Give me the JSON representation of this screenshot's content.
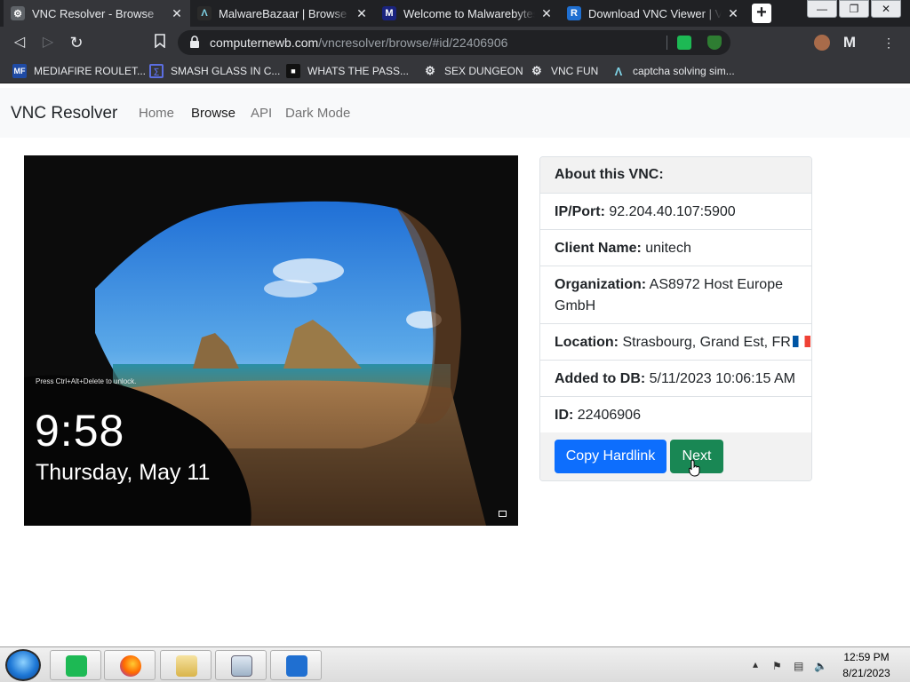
{
  "browser": {
    "tabs": [
      {
        "title": "VNC Resolver - Browse",
        "active": true
      },
      {
        "title": "MalwareBazaar | Browse Che",
        "active": false
      },
      {
        "title": "Welcome to Malwarebytes B",
        "active": false
      },
      {
        "title": "Download VNC Viewer | VNC",
        "active": false
      }
    ],
    "new_tab_label": "+",
    "url_host": "computernewb.com",
    "url_path": "/vncresolver/browse/#id/22406906",
    "bookmarks": [
      {
        "label": "MEDIAFIRE ROULET..."
      },
      {
        "label": "SMASH GLASS IN C..."
      },
      {
        "label": "WHATS THE PASS..."
      },
      {
        "label": "SEX DUNGEON"
      },
      {
        "label": "VNC FUN"
      },
      {
        "label": "captcha solving sim..."
      }
    ]
  },
  "site": {
    "brand": "VNC Resolver",
    "nav": [
      "Home",
      "Browse",
      "API",
      "Dark Mode"
    ],
    "active_nav": "Browse"
  },
  "screenshot": {
    "hint": "Press Ctrl+Alt+Delete to unlock.",
    "time": "9:58",
    "date": "Thursday, May 11"
  },
  "details": {
    "header": "About this VNC:",
    "ip_port_label": "IP/Port:",
    "ip_port": "92.204.40.107:5900",
    "client_name_label": "Client Name:",
    "client_name": "unitech",
    "organization_label": "Organization:",
    "organization_line1": "AS8972 Host Europe",
    "organization_line2": "GmbH",
    "location_label": "Location:",
    "location": "Strasbourg, Grand Est, FR",
    "added_label": "Added to DB:",
    "added": "5/11/2023 10:06:15 AM",
    "id_label": "ID:",
    "id": "22406906",
    "copy_button": "Copy Hardlink",
    "next_button": "Next"
  },
  "taskbar": {
    "time": "12:59 PM",
    "date": "8/21/2023"
  },
  "colors": {
    "primary": "#0d6efd",
    "success": "#198754",
    "chrome_dark": "#202124",
    "chrome_toolbar": "#35363a"
  }
}
